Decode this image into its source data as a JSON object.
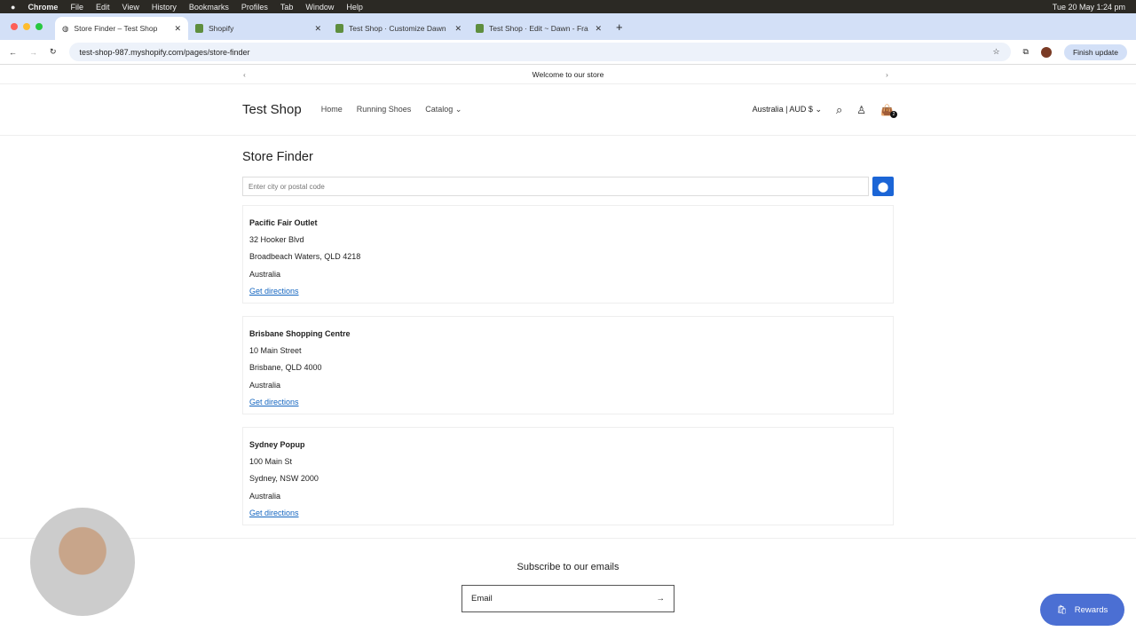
{
  "menubar": {
    "items": [
      "Chrome",
      "File",
      "Edit",
      "View",
      "History",
      "Bookmarks",
      "Profiles",
      "Tab",
      "Window",
      "Help"
    ],
    "datetime": "Tue 20 May  1:24 pm"
  },
  "tabs": [
    {
      "label": "Store Finder – Test Shop"
    },
    {
      "label": "Shopify"
    },
    {
      "label": "Test Shop · Customize Dawn"
    },
    {
      "label": "Test Shop · Edit ~ Dawn - Fra"
    }
  ],
  "address": {
    "url": "test-shop-987.myshopify.com/pages/store-finder",
    "finish_update": "Finish update"
  },
  "announcement": "Welcome to our store",
  "header": {
    "logo": "Test Shop",
    "nav": [
      "Home",
      "Running Shoes",
      "Catalog"
    ],
    "locale": "Australia | AUD $",
    "cart_count": "2"
  },
  "page": {
    "title": "Store Finder",
    "search_placeholder": "Enter city or postal code",
    "stores": [
      {
        "name": "Pacific Fair Outlet",
        "street": "32 Hooker Blvd",
        "city": "Broadbeach Waters, QLD 4218",
        "country": "Australia",
        "link": "Get directions"
      },
      {
        "name": "Brisbane Shopping Centre",
        "street": "10 Main Street",
        "city": "Brisbane, QLD 4000",
        "country": "Australia",
        "link": "Get directions"
      },
      {
        "name": "Sydney Popup",
        "street": "100 Main St",
        "city": "Sydney, NSW 2000",
        "country": "Australia",
        "link": "Get directions"
      }
    ]
  },
  "footer": {
    "subscribe": "Subscribe to our emails",
    "email_placeholder": "Email"
  },
  "rewards": "Rewards"
}
